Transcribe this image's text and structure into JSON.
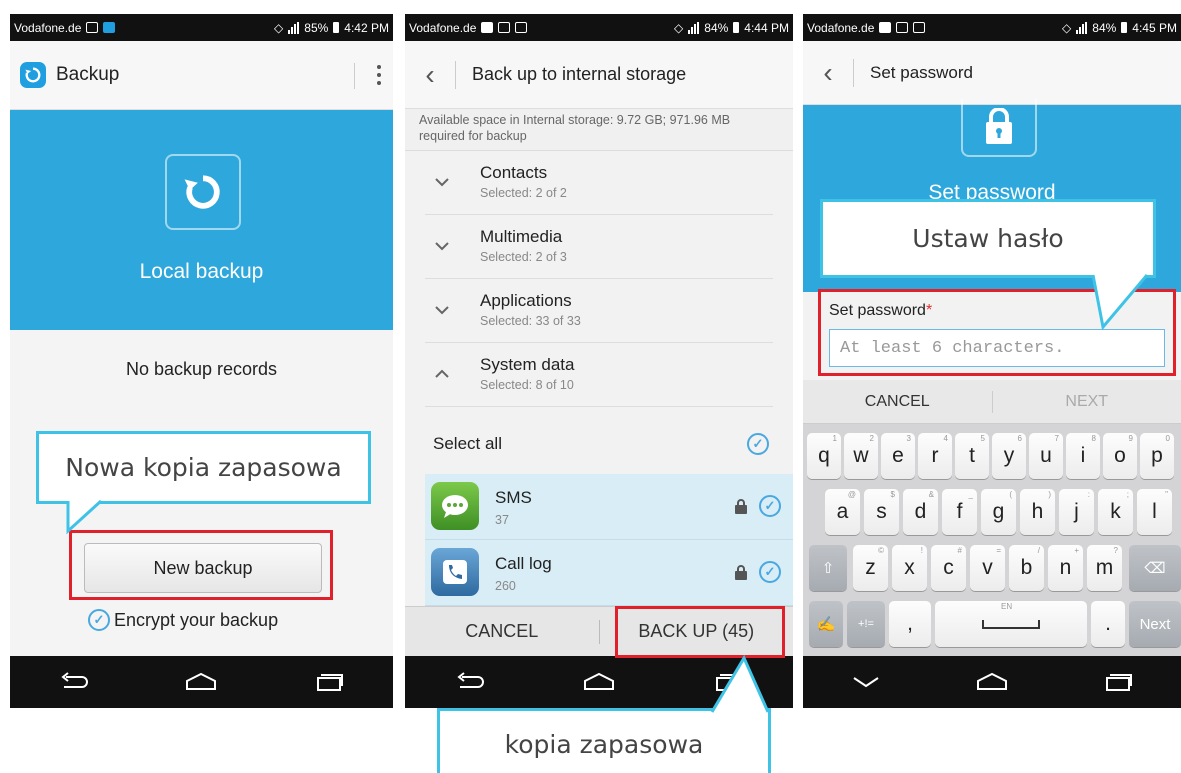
{
  "phone1": {
    "status": {
      "carrier": "Vodafone.de",
      "battery": "85%",
      "time": "4:42 PM"
    },
    "app_title": "Backup",
    "hero_label": "Local backup",
    "no_records": "No backup records",
    "new_backup_label": "New backup",
    "encrypt_label": "Encrypt your backup",
    "callout": "Nowa kopia zapasowa"
  },
  "phone2": {
    "status": {
      "carrier": "Vodafone.de",
      "battery": "84%",
      "time": "4:44 PM"
    },
    "title": "Back up to internal storage",
    "available_space": "Available space in Internal storage: 9.72 GB; 971.96 MB required for backup",
    "categories": [
      {
        "name": "Contacts",
        "selected": "Selected: 2 of 2",
        "expanded": false
      },
      {
        "name": "Multimedia",
        "selected": "Selected: 2 of 3",
        "expanded": false
      },
      {
        "name": "Applications",
        "selected": "Selected: 33 of 33",
        "expanded": false
      },
      {
        "name": "System data",
        "selected": "Selected: 8 of 10",
        "expanded": true
      }
    ],
    "select_all": "Select all",
    "items": [
      {
        "name": "SMS",
        "count": "37",
        "icon": "sms-icon"
      },
      {
        "name": "Call log",
        "count": "260",
        "icon": "call-log-icon"
      }
    ],
    "cancel_label": "CANCEL",
    "backup_label": "BACK UP (45)",
    "callout": "kopia zapasowa"
  },
  "phone3": {
    "status": {
      "carrier": "Vodafone.de",
      "battery": "84%",
      "time": "4:45 PM"
    },
    "title": "Set password",
    "hero_label": "Set password",
    "field_label": "Set password",
    "required_mark": "*",
    "placeholder": "At least 6 characters.",
    "cancel_label": "CANCEL",
    "next_label": "NEXT",
    "keyboard": {
      "row1": [
        "q",
        "w",
        "e",
        "r",
        "t",
        "y",
        "u",
        "i",
        "o",
        "p"
      ],
      "row1_hints": [
        "1",
        "2",
        "3",
        "4",
        "5",
        "6",
        "7",
        "8",
        "9",
        "0"
      ],
      "row2": [
        "a",
        "s",
        "d",
        "f",
        "g",
        "h",
        "j",
        "k",
        "l"
      ],
      "row2_hints": [
        "@",
        "$",
        "&",
        "_",
        "(",
        ")",
        ":",
        ";",
        "\""
      ],
      "row3": [
        "z",
        "x",
        "c",
        "v",
        "b",
        "n",
        "m"
      ],
      "row3_hints": [
        "©",
        "!",
        "#",
        "=",
        "/",
        "+",
        "?"
      ],
      "symbols_key": "+!=",
      "comma_key": ",",
      "space_hint": "EN",
      "period_key": ".",
      "next_key": "Next"
    },
    "callout": "Ustaw hasło"
  },
  "colors": {
    "accent": "#2ea8dc",
    "callout_border": "#3ec3e6",
    "highlight_red": "#e0212b"
  }
}
